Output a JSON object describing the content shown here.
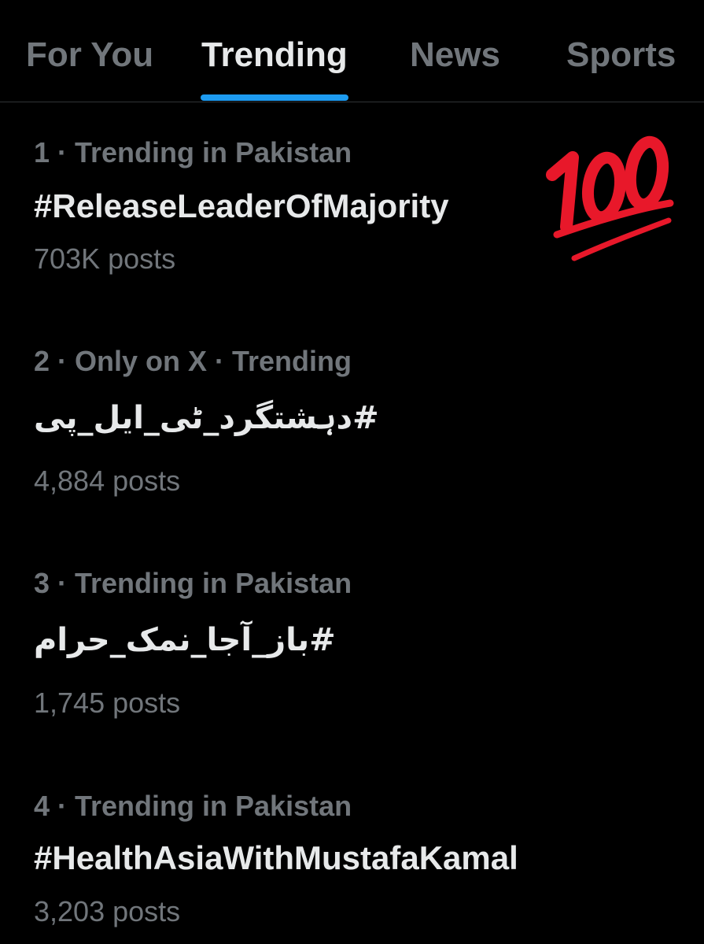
{
  "tabs": [
    {
      "label": "For You",
      "active": false
    },
    {
      "label": "Trending",
      "active": true
    },
    {
      "label": "News",
      "active": false
    },
    {
      "label": "Sports",
      "active": false
    }
  ],
  "accent_color": "#1d9bf0",
  "trends": [
    {
      "meta": "1 · Trending in Pakistan",
      "name": "#ReleaseLeaderOfMajority",
      "posts": "703K posts"
    },
    {
      "meta": "2 · Only on X · Trending",
      "name": "#دہشتگرد_ٹی_ایل_پی",
      "posts": "4,884 posts"
    },
    {
      "meta": "3 · Trending in Pakistan",
      "name": "#باز_آجا_نمک_حرام",
      "posts": "1,745 posts"
    },
    {
      "meta": "4 · Trending in Pakistan",
      "name": "#HealthAsiaWithMustafaKamal",
      "posts": "3,203 posts"
    }
  ],
  "decoration": {
    "icon": "hundred-points-emoji-icon",
    "color": "#e8182a"
  }
}
